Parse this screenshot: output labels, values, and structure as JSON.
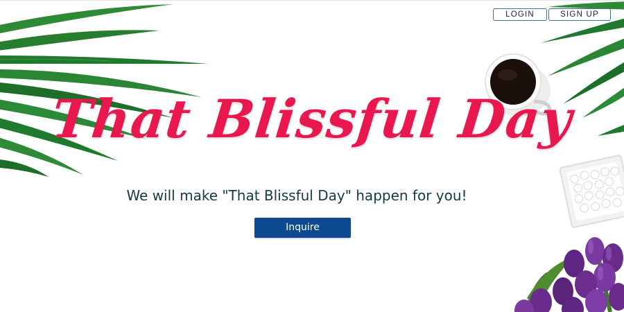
{
  "header": {
    "login_label": "LOGIN",
    "signup_label": "SIGN UP"
  },
  "hero": {
    "title": "That Blissful Day",
    "subtitle": "We will make \"That Blissful Day\" happen for you!",
    "inquire_label": "Inquire"
  },
  "colors": {
    "title_pink": "#e8174e",
    "button_blue": "#0e4a8f",
    "subtitle_teal": "#123a3f",
    "leaf_green": "#1f7a2e",
    "tulip_purple": "#6a2c8c"
  },
  "decorations": [
    "palm-leaves",
    "coffee-cup",
    "mint-bowl",
    "purple-tulips"
  ]
}
